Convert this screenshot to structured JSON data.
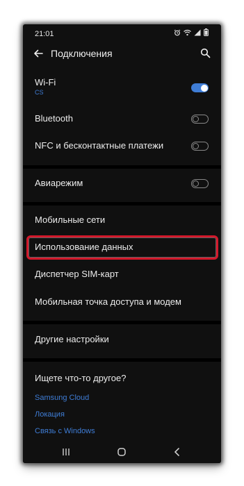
{
  "status_bar": {
    "time": "21:01",
    "icons": [
      "alarm-icon",
      "wifi-icon",
      "signal-icon",
      "battery-icon"
    ]
  },
  "header": {
    "title": "Подключения",
    "back_icon": "back-arrow-icon",
    "search_icon": "search-icon"
  },
  "settings": {
    "wifi": {
      "label": "Wi-Fi",
      "sublabel": "CS",
      "enabled": true
    },
    "bluetooth": {
      "label": "Bluetooth",
      "enabled": false
    },
    "nfc": {
      "label": "NFC и бесконтактные платежи",
      "enabled": false
    },
    "airplane": {
      "label": "Авиарежим",
      "enabled": false
    },
    "mobile_networks": {
      "label": "Мобильные сети"
    },
    "data_usage": {
      "label": "Использование данных",
      "highlighted": true
    },
    "sim_manager": {
      "label": "Диспетчер SIM-карт"
    },
    "hotspot": {
      "label": "Мобильная точка доступа и модем"
    },
    "other": {
      "label": "Другие настройки"
    }
  },
  "suggestions": {
    "title": "Ищете что-то другое?",
    "links": [
      "Samsung Cloud",
      "Локация",
      "Связь с Windows"
    ]
  },
  "nav_bar": {
    "icons": [
      "recent-apps-icon",
      "home-icon",
      "back-icon"
    ]
  },
  "colors": {
    "accent": "#3f7dd6",
    "highlight": "#d3182b",
    "background": "#101010"
  }
}
